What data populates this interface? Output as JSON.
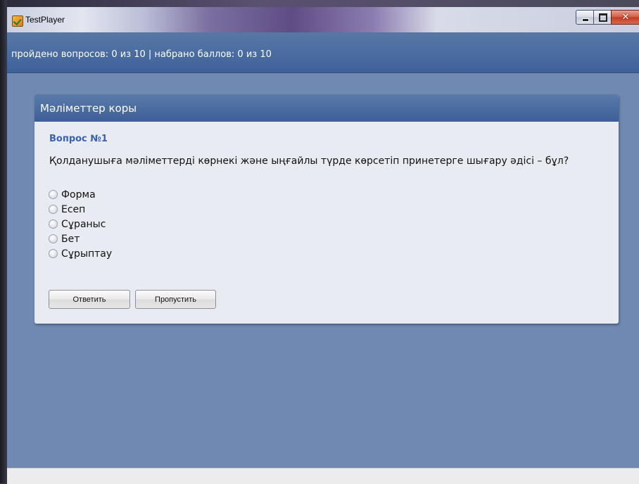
{
  "window": {
    "title": "TestPlayer"
  },
  "status": {
    "text": "пройдено вопросов: 0 из 10 | набрано баллов: 0 из 10"
  },
  "card": {
    "title": "Мәліметтер коры",
    "question_number": "Вопрос №1",
    "question_text": "Қолданушыға мәліметтерді көрнекі және ыңғайлы түрде көрсетіп принетерге шығару әдісі – бұл?",
    "options": [
      {
        "label": "Форма",
        "selected": false
      },
      {
        "label": "Есеп",
        "selected": false
      },
      {
        "label": "Сұраныс",
        "selected": false
      },
      {
        "label": "Бет",
        "selected": false
      },
      {
        "label": "Сұрыптау",
        "selected": false
      }
    ],
    "buttons": {
      "answer": "Ответить",
      "skip": "Пропустить"
    }
  }
}
